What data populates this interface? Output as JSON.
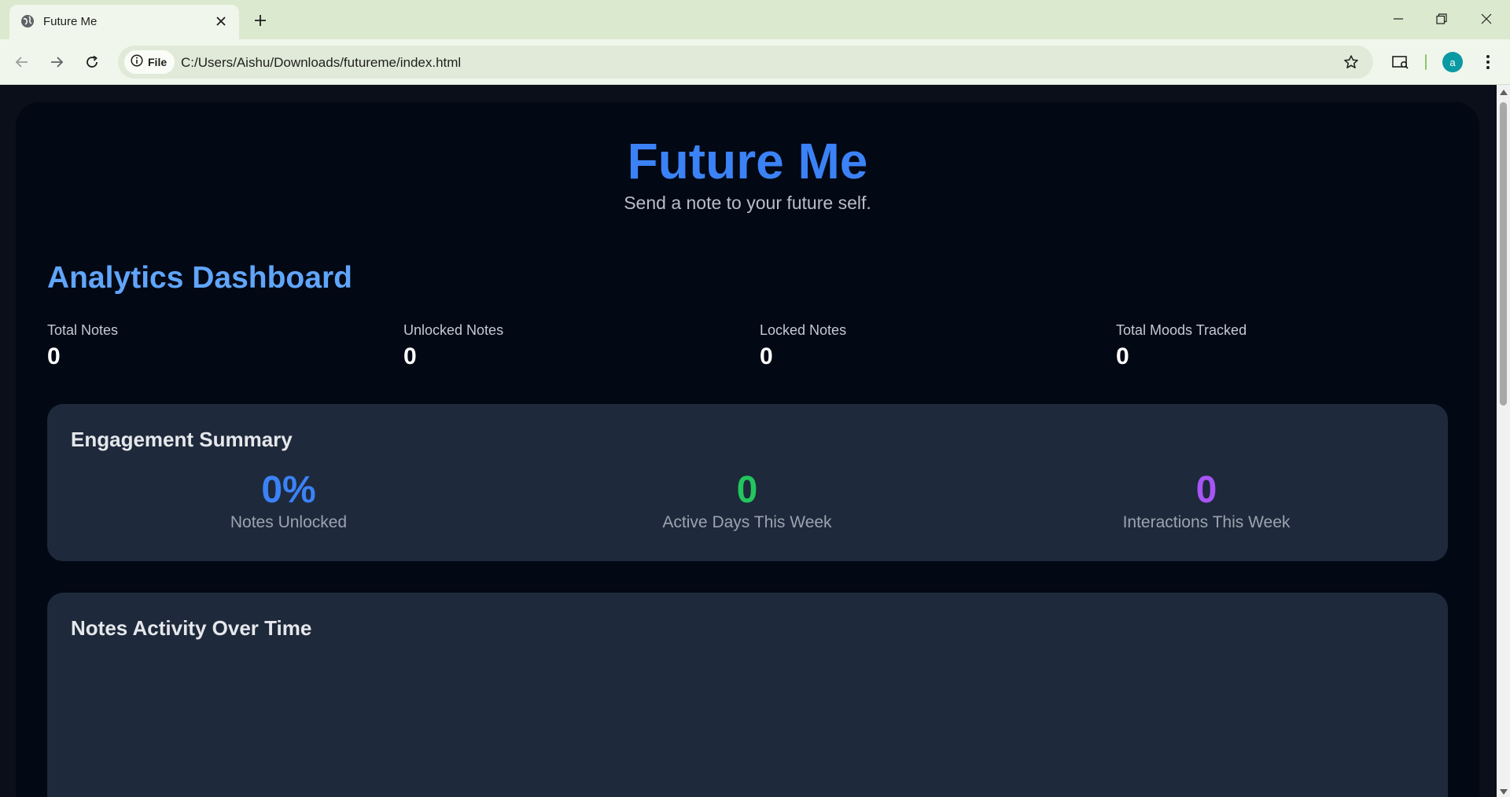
{
  "browser": {
    "tab_title": "Future Me",
    "omnibox_chip": "File",
    "url": "C:/Users/Aishu/Downloads/futureme/index.html",
    "profile_initial": "a"
  },
  "page": {
    "brand": "Future Me",
    "tagline": "Send a note to your future self.",
    "dashboard_title": "Analytics Dashboard",
    "stats": [
      {
        "label": "Total Notes",
        "value": "0"
      },
      {
        "label": "Unlocked Notes",
        "value": "0"
      },
      {
        "label": "Locked Notes",
        "value": "0"
      },
      {
        "label": "Total Moods Tracked",
        "value": "0"
      }
    ],
    "engagement": {
      "title": "Engagement Summary",
      "metrics": [
        {
          "value": "0%",
          "label": "Notes Unlocked",
          "color": "#3b82f6"
        },
        {
          "value": "0",
          "label": "Active Days This Week",
          "color": "#22c55e"
        },
        {
          "value": "0",
          "label": "Interactions This Week",
          "color": "#a855f7"
        }
      ]
    },
    "activity": {
      "title": "Notes Activity Over Time"
    }
  },
  "colors": {
    "brand": "#3b82f6",
    "section_title": "#60a5fa",
    "card_bg": "#1e293b",
    "page_bg": "#020814"
  }
}
